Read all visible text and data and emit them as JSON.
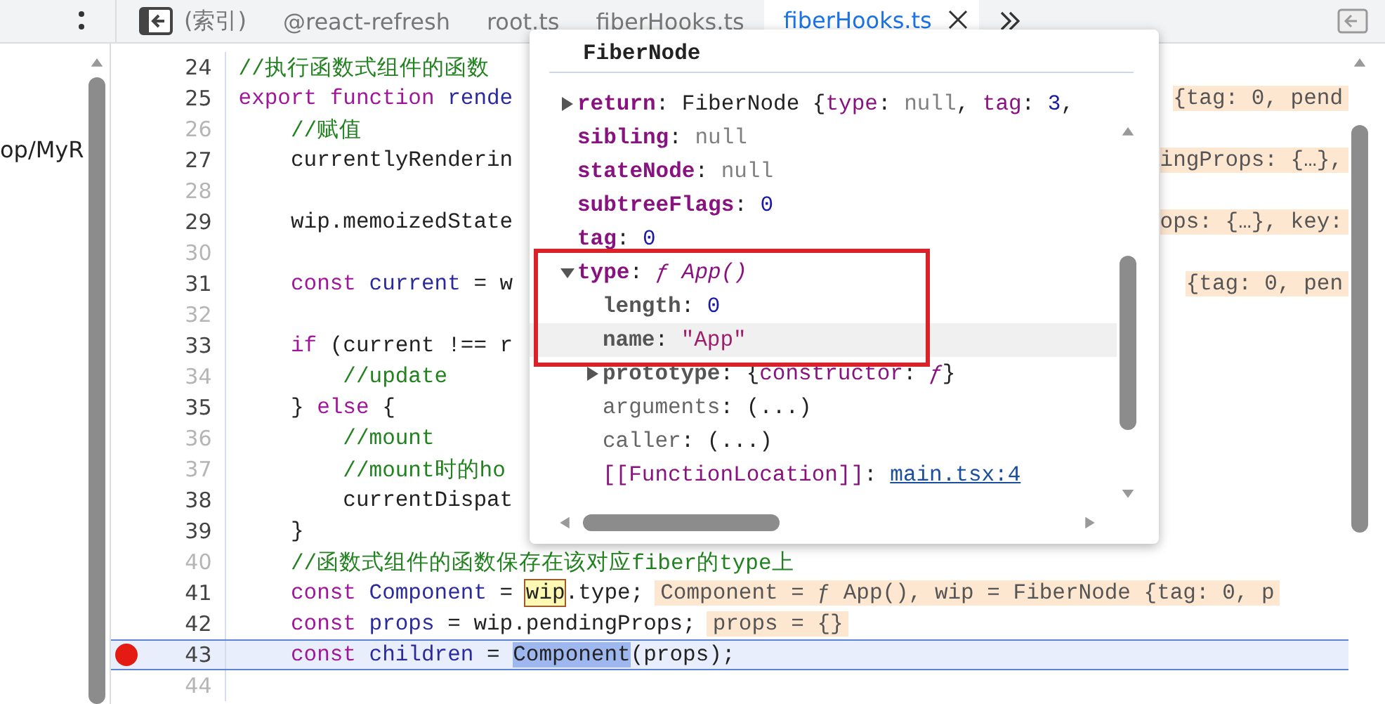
{
  "tabs": [
    {
      "label": "(索引)",
      "selected": false
    },
    {
      "label": "@react-refresh",
      "selected": false
    },
    {
      "label": "root.ts",
      "selected": false
    },
    {
      "label": "fiberHooks.ts",
      "selected": false
    },
    {
      "label": "fiberHooks.ts",
      "selected": true
    }
  ],
  "sidebar": {
    "items": [
      "op/MyR"
    ]
  },
  "editor": {
    "lines": [
      {
        "num": "24",
        "dim": false,
        "breakpoint": false,
        "current": false,
        "code": [
          {
            "t": "//执行函数式组件的函数",
            "kind": "comment"
          }
        ]
      },
      {
        "num": "25",
        "dim": false,
        "breakpoint": false,
        "current": false,
        "code": [
          {
            "t": "export function ",
            "kind": "keyword"
          },
          {
            "t": "rende",
            "kind": "name"
          }
        ],
        "right_value": "{tag: 0, pend"
      },
      {
        "num": "26",
        "dim": true,
        "breakpoint": false,
        "current": false,
        "code": [
          {
            "t": "    //赋值",
            "kind": "comment"
          }
        ]
      },
      {
        "num": "27",
        "dim": false,
        "breakpoint": false,
        "current": false,
        "code": [
          {
            "t": "    currentlyRenderin",
            "kind": "plain"
          }
        ],
        "right_value": "ingProps: {…},"
      },
      {
        "num": "28",
        "dim": true,
        "breakpoint": false,
        "current": false
      },
      {
        "num": "29",
        "dim": false,
        "breakpoint": false,
        "current": false,
        "code": [
          {
            "t": "    wip.memoizedState",
            "kind": "plain"
          }
        ],
        "right_value": "ops: {…}, key:"
      },
      {
        "num": "30",
        "dim": true,
        "breakpoint": false,
        "current": false
      },
      {
        "num": "31",
        "dim": false,
        "breakpoint": false,
        "current": false,
        "code": [
          {
            "t": "    const ",
            "kind": "keyword"
          },
          {
            "t": "current",
            "kind": "name"
          },
          {
            "t": " = w",
            "kind": "plain"
          }
        ],
        "right_value": "{tag: 0, pen"
      },
      {
        "num": "32",
        "dim": true,
        "breakpoint": false,
        "current": false
      },
      {
        "num": "33",
        "dim": false,
        "breakpoint": false,
        "current": false,
        "code": [
          {
            "t": "    if",
            "kind": "keyword"
          },
          {
            "t": " (current !== r",
            "kind": "plain"
          }
        ]
      },
      {
        "num": "34",
        "dim": true,
        "breakpoint": false,
        "current": false,
        "code": [
          {
            "t": "        //update",
            "kind": "comment"
          }
        ]
      },
      {
        "num": "35",
        "dim": false,
        "breakpoint": false,
        "current": false,
        "code": [
          {
            "t": "    } ",
            "kind": "plain"
          },
          {
            "t": "else",
            "kind": "keyword"
          },
          {
            "t": " {",
            "kind": "plain"
          }
        ]
      },
      {
        "num": "36",
        "dim": true,
        "breakpoint": false,
        "current": false,
        "code": [
          {
            "t": "        //mount",
            "kind": "comment"
          }
        ]
      },
      {
        "num": "37",
        "dim": true,
        "breakpoint": false,
        "current": false,
        "code": [
          {
            "t": "        //mount时的ho",
            "kind": "comment"
          }
        ]
      },
      {
        "num": "38",
        "dim": false,
        "breakpoint": false,
        "current": false,
        "code": [
          {
            "t": "        currentDispat",
            "kind": "plain"
          }
        ]
      },
      {
        "num": "39",
        "dim": false,
        "breakpoint": false,
        "current": false,
        "code": [
          {
            "t": "    }",
            "kind": "plain"
          }
        ]
      },
      {
        "num": "40",
        "dim": true,
        "breakpoint": false,
        "current": false,
        "code": [
          {
            "t": "    //函数式组件的函数保存在该对应fiber的type上",
            "kind": "comment"
          }
        ]
      },
      {
        "num": "41",
        "dim": false,
        "breakpoint": false,
        "current": false,
        "code": [
          {
            "t": "    const ",
            "kind": "keyword"
          },
          {
            "t": "Component",
            "kind": "name"
          },
          {
            "t": " = ",
            "kind": "plain"
          },
          {
            "t": "wip",
            "kind": "hover"
          },
          {
            "t": ".type;",
            "kind": "plain"
          }
        ],
        "inline_value": "Component = ƒ App(), wip = FiberNode {tag: 0, p"
      },
      {
        "num": "42",
        "dim": false,
        "breakpoint": false,
        "current": false,
        "code": [
          {
            "t": "    const ",
            "kind": "keyword"
          },
          {
            "t": "props",
            "kind": "name"
          },
          {
            "t": " = wip.pendingProps;",
            "kind": "plain"
          }
        ],
        "inline_value": "props = {}"
      },
      {
        "num": "43",
        "dim": false,
        "breakpoint": true,
        "current": true,
        "code": [
          {
            "t": "    const ",
            "kind": "keyword"
          },
          {
            "t": "children",
            "kind": "name"
          },
          {
            "t": " = ",
            "kind": "plain"
          },
          {
            "t": "Component",
            "kind": "selection"
          },
          {
            "t": "(props);",
            "kind": "plain"
          }
        ]
      },
      {
        "num": "44",
        "dim": true,
        "breakpoint": false,
        "current": false
      }
    ]
  },
  "popover": {
    "title": "FiberNode",
    "rows": [
      {
        "expanded": false,
        "selected": false,
        "text": [
          {
            "t": "return",
            "kind": "own"
          },
          {
            "t": ": FiberNode {",
            "kind": "plain"
          },
          {
            "t": "type",
            "kind": "key"
          },
          {
            "t": ": ",
            "kind": "plain"
          },
          {
            "t": "null",
            "kind": "null"
          },
          {
            "t": ", ",
            "kind": "plain"
          },
          {
            "t": "tag",
            "kind": "key"
          },
          {
            "t": ": ",
            "kind": "plain"
          },
          {
            "t": "3",
            "kind": "number"
          },
          {
            "t": ",",
            "kind": "plain"
          }
        ]
      },
      {
        "selected": false,
        "text": [
          {
            "t": "sibling",
            "kind": "own"
          },
          {
            "t": ": ",
            "kind": "plain"
          },
          {
            "t": "null",
            "kind": "null"
          }
        ]
      },
      {
        "selected": false,
        "text": [
          {
            "t": "stateNode",
            "kind": "own"
          },
          {
            "t": ": ",
            "kind": "plain"
          },
          {
            "t": "null",
            "kind": "null"
          }
        ]
      },
      {
        "selected": false,
        "text": [
          {
            "t": "subtreeFlags",
            "kind": "own"
          },
          {
            "t": ": ",
            "kind": "plain"
          },
          {
            "t": "0",
            "kind": "number"
          }
        ]
      },
      {
        "selected": false,
        "text": [
          {
            "t": "tag",
            "kind": "own"
          },
          {
            "t": ": ",
            "kind": "plain"
          },
          {
            "t": "0",
            "kind": "number"
          }
        ]
      },
      {
        "expanded": true,
        "selected": false,
        "text": [
          {
            "t": "type",
            "kind": "own"
          },
          {
            "t": ": ",
            "kind": "plain"
          },
          {
            "t": "ƒ App()",
            "kind": "function"
          }
        ],
        "children": [
          {
            "selected": false,
            "text": [
              {
                "t": "length",
                "kind": "builtin"
              },
              {
                "t": ": ",
                "kind": "plain"
              },
              {
                "t": "0",
                "kind": "number"
              }
            ]
          },
          {
            "selected": true,
            "text": [
              {
                "t": "name",
                "kind": "builtin"
              },
              {
                "t": ": ",
                "kind": "plain"
              },
              {
                "t": "\"App\"",
                "kind": "string"
              }
            ]
          },
          {
            "expanded": false,
            "selected": false,
            "text": [
              {
                "t": "prototype",
                "kind": "builtin"
              },
              {
                "t": ": {",
                "kind": "plain"
              },
              {
                "t": "constructor",
                "kind": "key"
              },
              {
                "t": ": ",
                "kind": "plain"
              },
              {
                "t": "ƒ",
                "kind": "function"
              },
              {
                "t": "}",
                "kind": "plain"
              }
            ]
          },
          {
            "selected": false,
            "text": [
              {
                "t": "arguments",
                "kind": "accessor"
              },
              {
                "t": ": (...)",
                "kind": "plain"
              }
            ]
          },
          {
            "selected": false,
            "text": [
              {
                "t": "caller",
                "kind": "accessor"
              },
              {
                "t": ": (...)",
                "kind": "plain"
              }
            ]
          },
          {
            "selected": false,
            "text": [
              {
                "t": "[[FunctionLocation]]",
                "kind": "internal"
              },
              {
                "t": ": ",
                "kind": "plain"
              }
            ],
            "link": "main.tsx:4"
          }
        ]
      }
    ]
  }
}
